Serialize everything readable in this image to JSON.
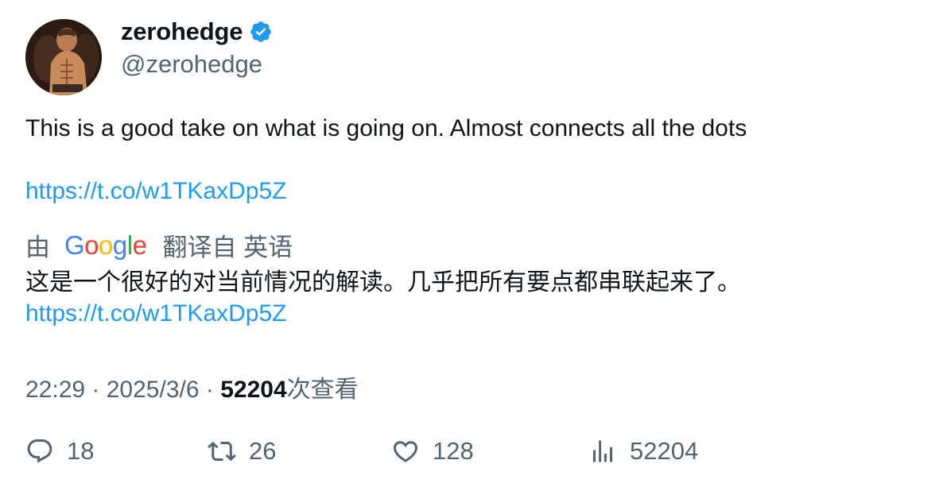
{
  "author": {
    "name": "zerohedge",
    "handle": "@zerohedge",
    "verified_color": "#1d9bf0"
  },
  "tweet": {
    "text": "This is a good take on what is going on. Almost connects all the dots",
    "link": "https://t.co/w1TKaxDp5Z"
  },
  "translation": {
    "by_prefix": "由",
    "provider": "Google",
    "source_label": "翻译自 英语",
    "text": "这是一个很好的对当前情况的解读。几乎把所有要点都串联起来了。",
    "link": "https://t.co/w1TKaxDp5Z"
  },
  "meta": {
    "time": "22:29",
    "date": "2025/3/6",
    "views_count": "52204",
    "views_suffix": "次查看"
  },
  "actions": {
    "replies": "18",
    "retweets": "26",
    "likes": "128",
    "views": "52204"
  },
  "icons": {
    "reply": "reply-icon",
    "retweet": "retweet-icon",
    "like": "heart-icon",
    "views": "bar-chart-icon",
    "verified": "verified-badge-icon"
  }
}
